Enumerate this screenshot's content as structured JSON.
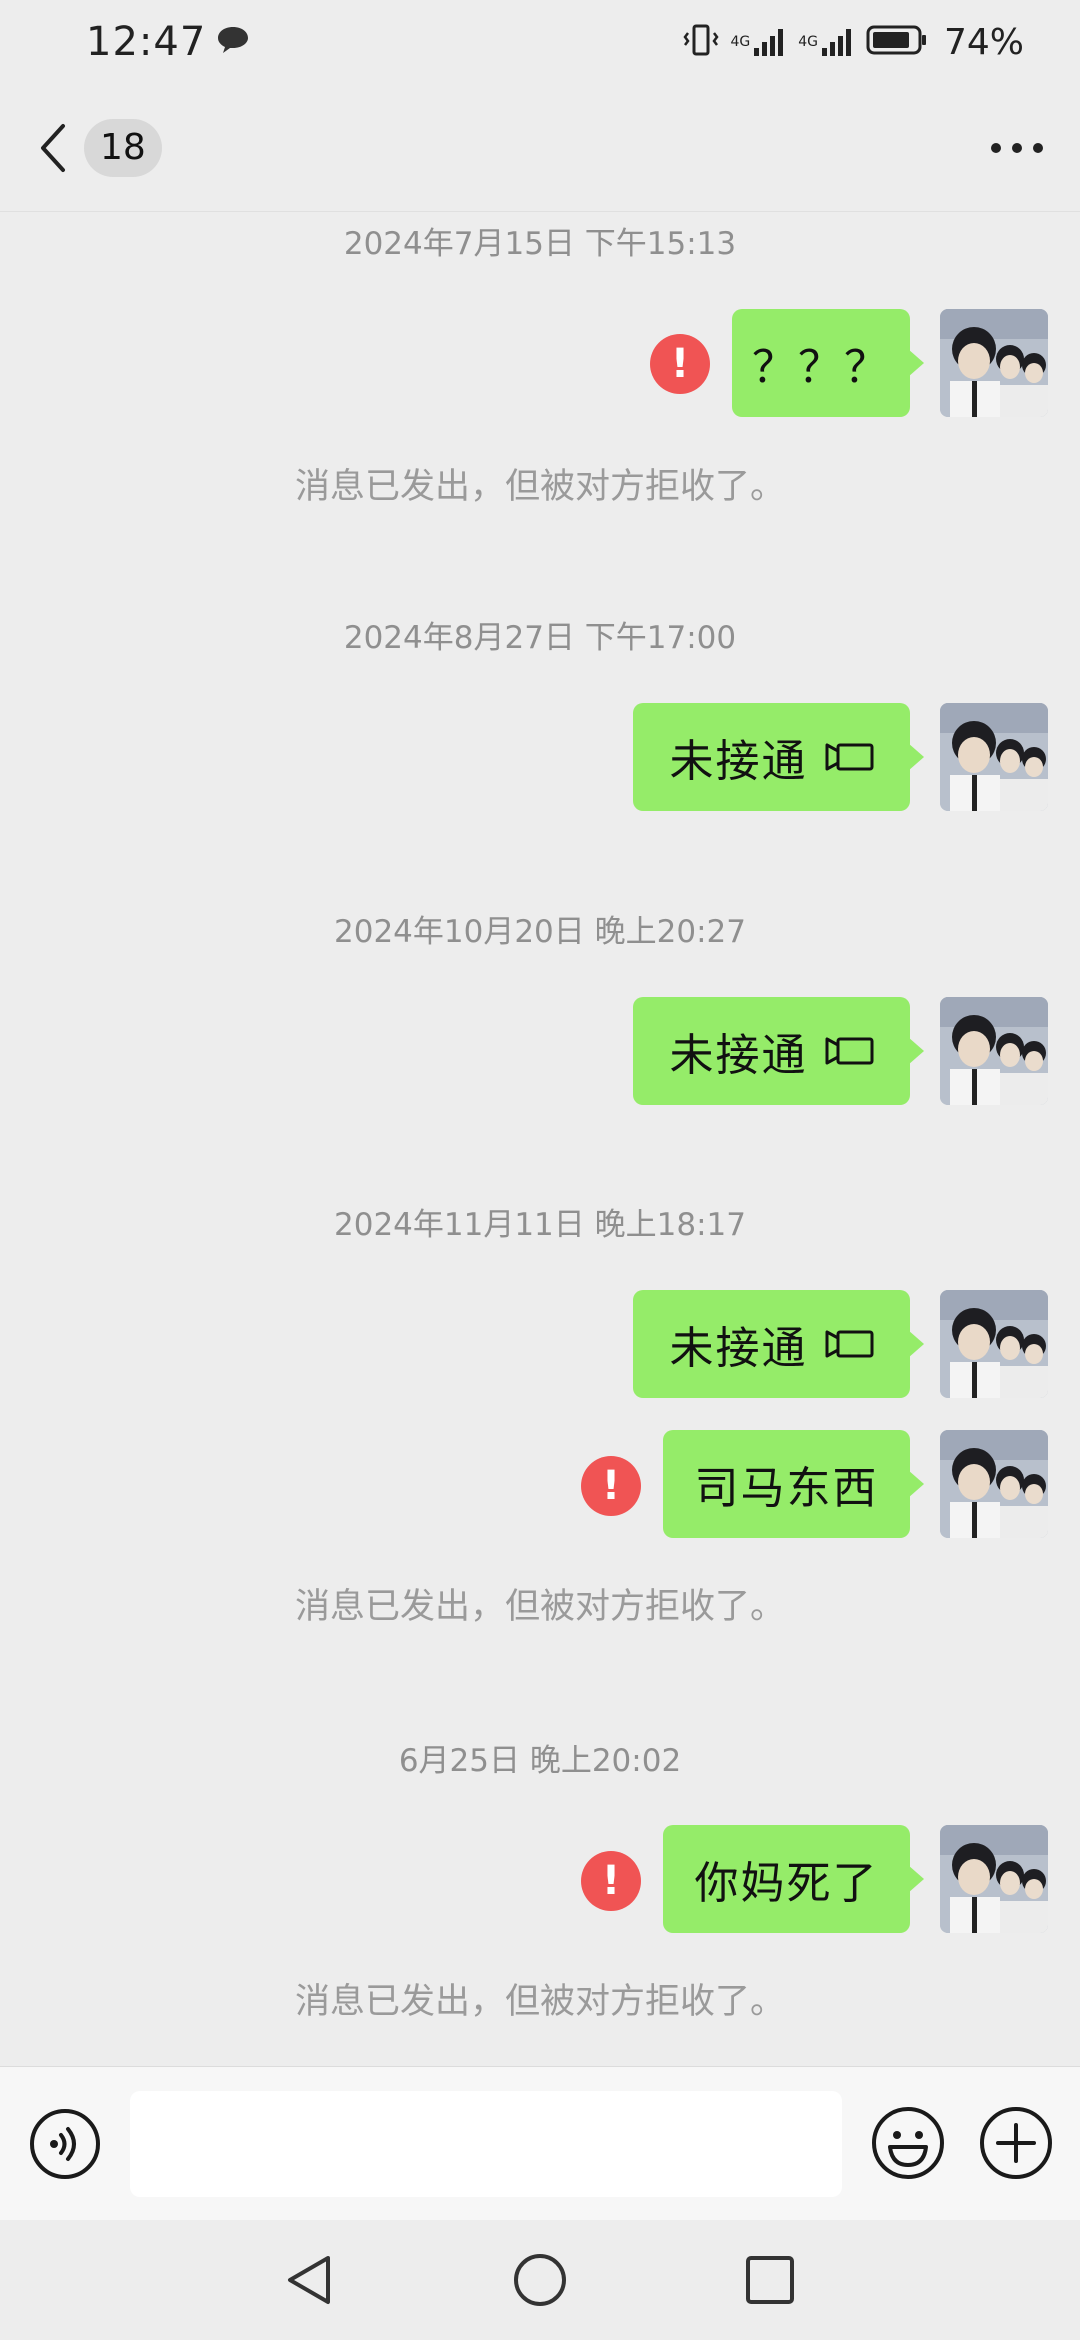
{
  "status_bar": {
    "time": "12:47",
    "battery": "74%",
    "sim1_label": "4G",
    "sim2_label": "4G"
  },
  "header": {
    "unread_count": "18"
  },
  "messages": [
    {
      "timestamp": "2024年7月15日 下午15:13",
      "text": "？？？",
      "failed": true,
      "notice": "消息已发出，但被对方拒收了。"
    },
    {
      "timestamp": "2024年8月27日 下午17:00",
      "text": "未接通",
      "type": "video-call"
    },
    {
      "timestamp": "2024年10月20日 晚上20:27",
      "text": "未接通",
      "type": "video-call"
    },
    {
      "timestamp": "2024年11月11日 晚上18:17",
      "text": "未接通",
      "type": "video-call"
    },
    {
      "text": "司马东西",
      "failed": true,
      "notice": "消息已发出，但被对方拒收了。"
    },
    {
      "timestamp": "6月25日 晚上20:02",
      "text": "你妈死了",
      "failed": true,
      "notice": "消息已发出，但被对方拒收了。"
    }
  ],
  "icons": {
    "error": "!",
    "error_color": "#f05454",
    "bubble_color": "#95ec69"
  }
}
